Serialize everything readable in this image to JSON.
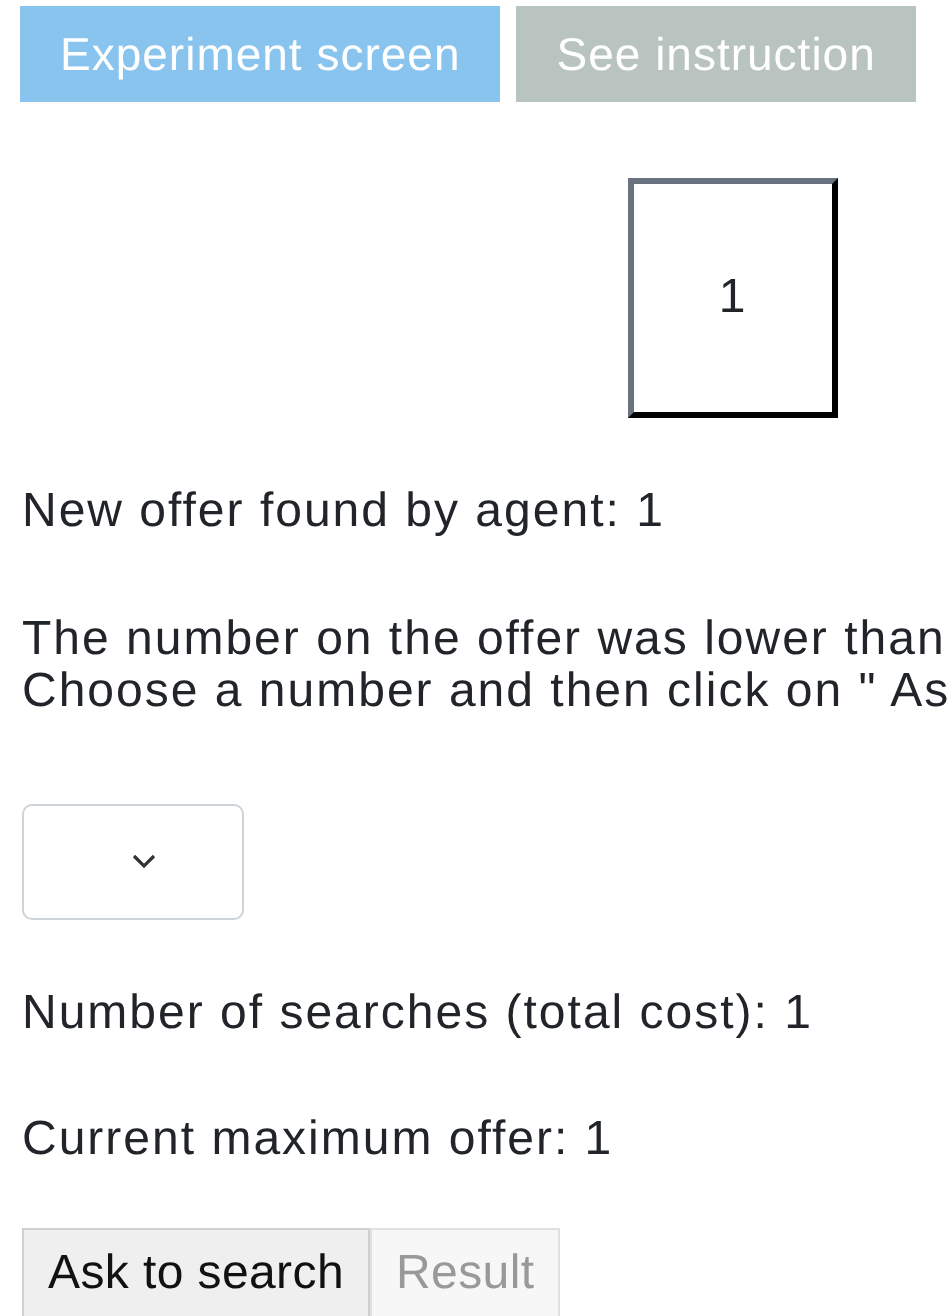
{
  "tabs": [
    {
      "label": "Experiment screen",
      "selected": true
    },
    {
      "label": "See instruction",
      "selected": false
    }
  ],
  "offer_card": {
    "value": "1"
  },
  "new_offer": "New offer found by agent: 1",
  "message_lines": [
    "The number on the offer was lower than",
    "Choose a number and then click on \" As"
  ],
  "searches": "Number of searches (total cost): 1",
  "max_offer": "Current maximum offer: 1",
  "buttons": [
    {
      "label": "Ask to search",
      "disabled": false
    },
    {
      "label": "Result",
      "disabled": true
    }
  ]
}
